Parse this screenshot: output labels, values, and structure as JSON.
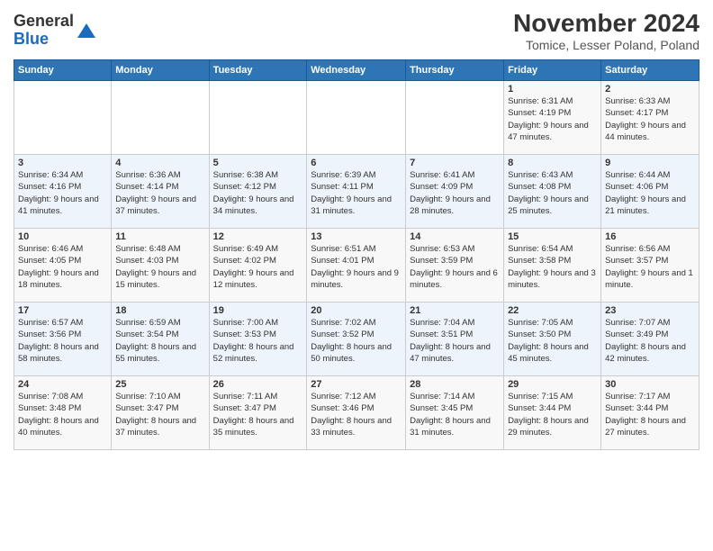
{
  "logo": {
    "general": "General",
    "blue": "Blue"
  },
  "title": "November 2024",
  "subtitle": "Tomice, Lesser Poland, Poland",
  "days_of_week": [
    "Sunday",
    "Monday",
    "Tuesday",
    "Wednesday",
    "Thursday",
    "Friday",
    "Saturday"
  ],
  "weeks": [
    [
      {
        "day": "",
        "info": ""
      },
      {
        "day": "",
        "info": ""
      },
      {
        "day": "",
        "info": ""
      },
      {
        "day": "",
        "info": ""
      },
      {
        "day": "",
        "info": ""
      },
      {
        "day": "1",
        "info": "Sunrise: 6:31 AM\nSunset: 4:19 PM\nDaylight: 9 hours and 47 minutes."
      },
      {
        "day": "2",
        "info": "Sunrise: 6:33 AM\nSunset: 4:17 PM\nDaylight: 9 hours and 44 minutes."
      }
    ],
    [
      {
        "day": "3",
        "info": "Sunrise: 6:34 AM\nSunset: 4:16 PM\nDaylight: 9 hours and 41 minutes."
      },
      {
        "day": "4",
        "info": "Sunrise: 6:36 AM\nSunset: 4:14 PM\nDaylight: 9 hours and 37 minutes."
      },
      {
        "day": "5",
        "info": "Sunrise: 6:38 AM\nSunset: 4:12 PM\nDaylight: 9 hours and 34 minutes."
      },
      {
        "day": "6",
        "info": "Sunrise: 6:39 AM\nSunset: 4:11 PM\nDaylight: 9 hours and 31 minutes."
      },
      {
        "day": "7",
        "info": "Sunrise: 6:41 AM\nSunset: 4:09 PM\nDaylight: 9 hours and 28 minutes."
      },
      {
        "day": "8",
        "info": "Sunrise: 6:43 AM\nSunset: 4:08 PM\nDaylight: 9 hours and 25 minutes."
      },
      {
        "day": "9",
        "info": "Sunrise: 6:44 AM\nSunset: 4:06 PM\nDaylight: 9 hours and 21 minutes."
      }
    ],
    [
      {
        "day": "10",
        "info": "Sunrise: 6:46 AM\nSunset: 4:05 PM\nDaylight: 9 hours and 18 minutes."
      },
      {
        "day": "11",
        "info": "Sunrise: 6:48 AM\nSunset: 4:03 PM\nDaylight: 9 hours and 15 minutes."
      },
      {
        "day": "12",
        "info": "Sunrise: 6:49 AM\nSunset: 4:02 PM\nDaylight: 9 hours and 12 minutes."
      },
      {
        "day": "13",
        "info": "Sunrise: 6:51 AM\nSunset: 4:01 PM\nDaylight: 9 hours and 9 minutes."
      },
      {
        "day": "14",
        "info": "Sunrise: 6:53 AM\nSunset: 3:59 PM\nDaylight: 9 hours and 6 minutes."
      },
      {
        "day": "15",
        "info": "Sunrise: 6:54 AM\nSunset: 3:58 PM\nDaylight: 9 hours and 3 minutes."
      },
      {
        "day": "16",
        "info": "Sunrise: 6:56 AM\nSunset: 3:57 PM\nDaylight: 9 hours and 1 minute."
      }
    ],
    [
      {
        "day": "17",
        "info": "Sunrise: 6:57 AM\nSunset: 3:56 PM\nDaylight: 8 hours and 58 minutes."
      },
      {
        "day": "18",
        "info": "Sunrise: 6:59 AM\nSunset: 3:54 PM\nDaylight: 8 hours and 55 minutes."
      },
      {
        "day": "19",
        "info": "Sunrise: 7:00 AM\nSunset: 3:53 PM\nDaylight: 8 hours and 52 minutes."
      },
      {
        "day": "20",
        "info": "Sunrise: 7:02 AM\nSunset: 3:52 PM\nDaylight: 8 hours and 50 minutes."
      },
      {
        "day": "21",
        "info": "Sunrise: 7:04 AM\nSunset: 3:51 PM\nDaylight: 8 hours and 47 minutes."
      },
      {
        "day": "22",
        "info": "Sunrise: 7:05 AM\nSunset: 3:50 PM\nDaylight: 8 hours and 45 minutes."
      },
      {
        "day": "23",
        "info": "Sunrise: 7:07 AM\nSunset: 3:49 PM\nDaylight: 8 hours and 42 minutes."
      }
    ],
    [
      {
        "day": "24",
        "info": "Sunrise: 7:08 AM\nSunset: 3:48 PM\nDaylight: 8 hours and 40 minutes."
      },
      {
        "day": "25",
        "info": "Sunrise: 7:10 AM\nSunset: 3:47 PM\nDaylight: 8 hours and 37 minutes."
      },
      {
        "day": "26",
        "info": "Sunrise: 7:11 AM\nSunset: 3:47 PM\nDaylight: 8 hours and 35 minutes."
      },
      {
        "day": "27",
        "info": "Sunrise: 7:12 AM\nSunset: 3:46 PM\nDaylight: 8 hours and 33 minutes."
      },
      {
        "day": "28",
        "info": "Sunrise: 7:14 AM\nSunset: 3:45 PM\nDaylight: 8 hours and 31 minutes."
      },
      {
        "day": "29",
        "info": "Sunrise: 7:15 AM\nSunset: 3:44 PM\nDaylight: 8 hours and 29 minutes."
      },
      {
        "day": "30",
        "info": "Sunrise: 7:17 AM\nSunset: 3:44 PM\nDaylight: 8 hours and 27 minutes."
      }
    ]
  ]
}
